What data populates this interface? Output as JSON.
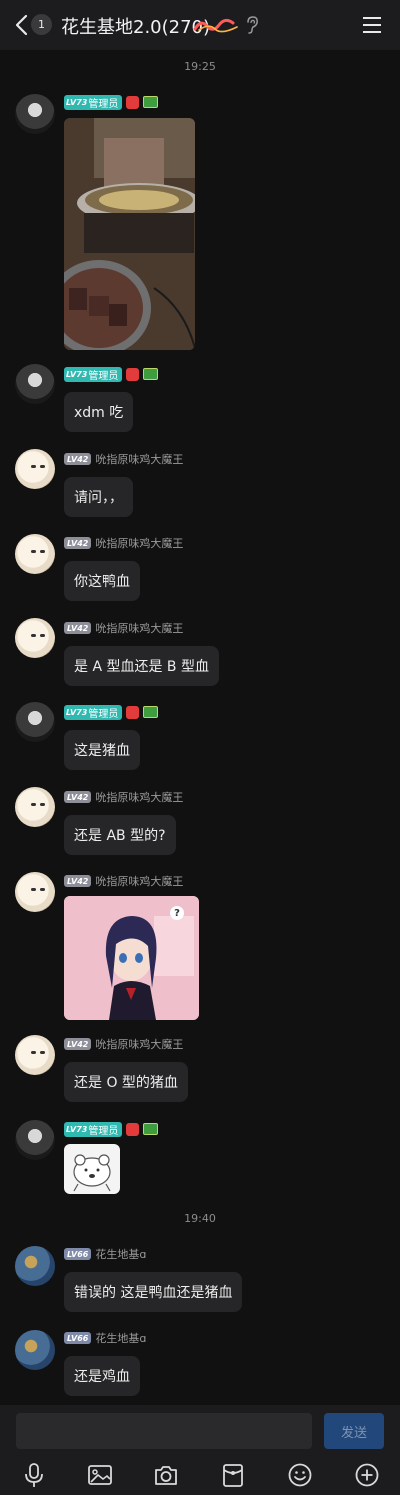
{
  "header": {
    "unread": "1",
    "title": "花生基地2.0(270)"
  },
  "times": [
    "19:25",
    "19:40"
  ],
  "roles": {
    "admin": "管理员"
  },
  "levels": {
    "lv73": "LV73",
    "lv42": "LV42",
    "lv66": "LV66"
  },
  "users": {
    "chick": "吮指原味鸡大魔王",
    "base": "花生地基ɑ"
  },
  "messages": [
    "xdm 吃",
    "请问，，",
    "你这鸭血",
    "是 A 型血还是 B 型血",
    "这是猪血",
    "还是 AB 型的?",
    "还是 O 型的猪血",
    "错误的 这是鸭血还是猪血",
    "还是鸡血"
  ],
  "composer": {
    "send_label": "发送"
  },
  "toolbar_icons": [
    "mic-icon",
    "image-icon",
    "camera-icon",
    "red-packet-icon",
    "emoji-icon",
    "plus-icon"
  ],
  "colors": {
    "accent_teal": "#2fb9b1",
    "send_bg": "#22477a",
    "bubble": "#262628",
    "background": "#111111"
  }
}
